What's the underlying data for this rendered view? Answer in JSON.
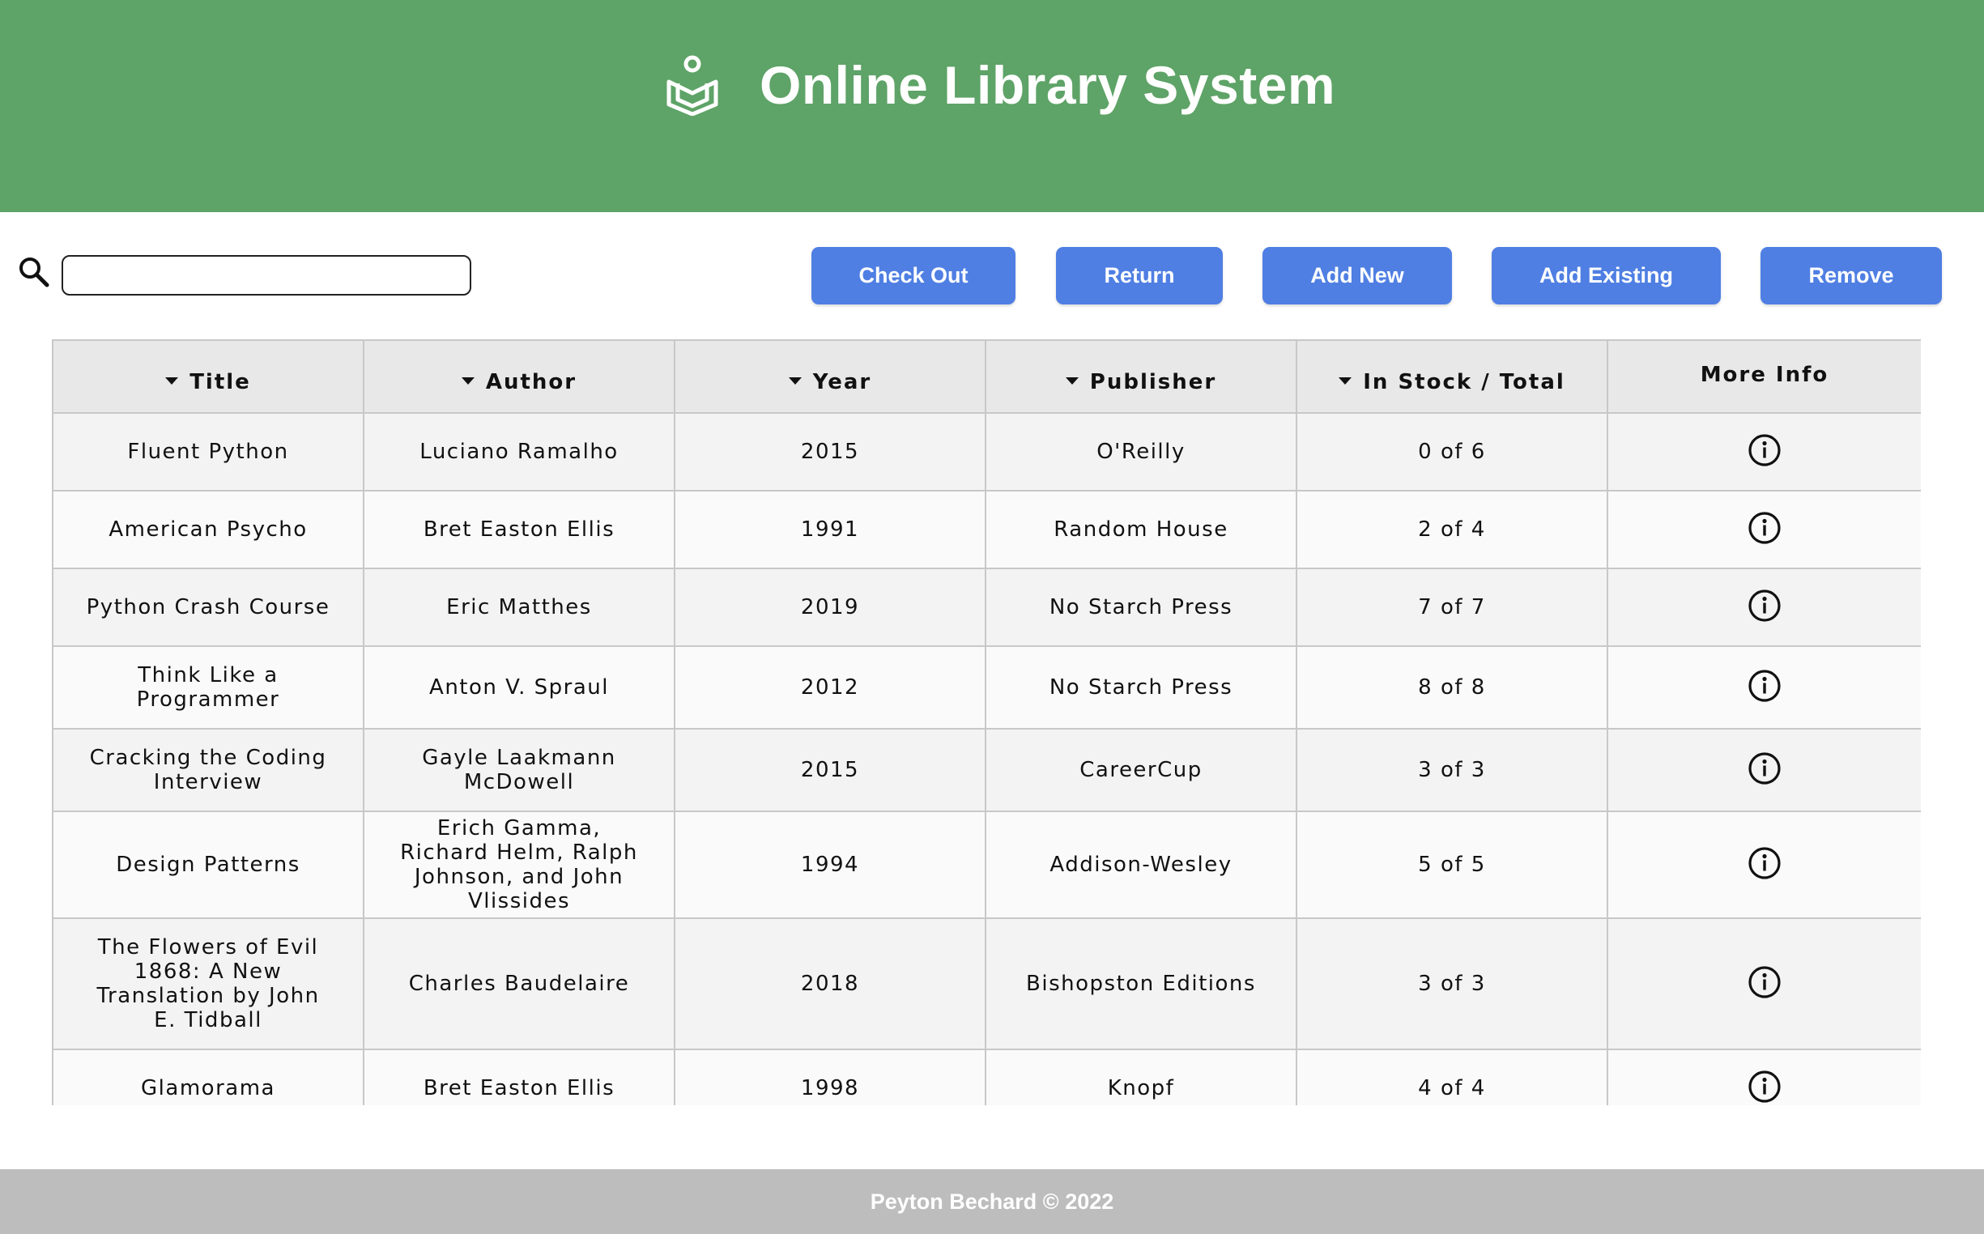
{
  "app": {
    "title": "Online Library System",
    "header_color": "#5ea367",
    "logo_icon": "book-reader-icon"
  },
  "search": {
    "placeholder": "",
    "value": "",
    "icon": "search-icon"
  },
  "toolbar": {
    "check_out_label": "Check Out",
    "return_label": "Return",
    "add_new_label": "Add New",
    "add_existing_label": "Add Existing",
    "remove_label": "Remove",
    "button_color": "#4f7fe3"
  },
  "table": {
    "headers": [
      "Title",
      "Author",
      "Year",
      "Publisher",
      "In Stock / Total",
      "More Info"
    ],
    "rows": [
      {
        "title": "Fluent Python",
        "author": "Luciano Ramalho",
        "year": "2015",
        "publisher": "O'Reilly",
        "stock": "0 of 6"
      },
      {
        "title": "American Psycho",
        "author": "Bret Easton Ellis",
        "year": "1991",
        "publisher": "Random House",
        "stock": "2 of 4"
      },
      {
        "title": "Python Crash Course",
        "author": "Eric Matthes",
        "year": "2019",
        "publisher": "No Starch Press",
        "stock": "7 of 7"
      },
      {
        "title": "Think Like a Programmer",
        "author": "Anton V. Spraul",
        "year": "2012",
        "publisher": "No Starch Press",
        "stock": "8 of 8"
      },
      {
        "title": "Cracking the Coding Interview",
        "author": "Gayle Laakmann McDowell",
        "year": "2015",
        "publisher": "CareerCup",
        "stock": "3 of 3"
      },
      {
        "title": "Design Patterns",
        "author": "Erich Gamma, Richard Helm, Ralph Johnson, and John Vlissides",
        "year": "1994",
        "publisher": "Addison-Wesley",
        "stock": "5 of 5"
      },
      {
        "title": "The Flowers of Evil 1868: A New Translation by John E. Tidball",
        "author": "Charles Baudelaire",
        "year": "2018",
        "publisher": "Bishopston Editions",
        "stock": "3 of 3"
      },
      {
        "title": "Glamorama",
        "author": "Bret Easton Ellis",
        "year": "1998",
        "publisher": "Knopf",
        "stock": "4 of 4"
      }
    ]
  },
  "footer": {
    "text": "Peyton Bechard © 2022"
  }
}
